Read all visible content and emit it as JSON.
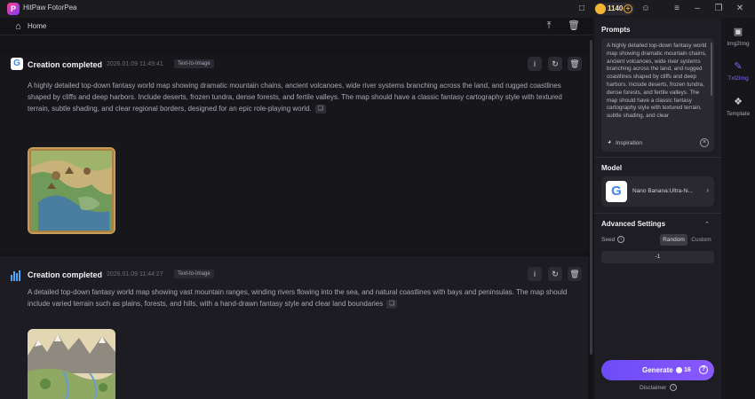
{
  "app": {
    "title": "HitPaw FotorPea",
    "credits": "1140"
  },
  "nav": {
    "home_label": "Home"
  },
  "cards": [
    {
      "title": "Creation completed",
      "time": "2026.01.09   11:49:41",
      "tag": "Text-to-Image",
      "description": "A highly detailed top-down fantasy world map showing dramatic mountain chains, ancient volcanoes, wide river systems branching across the land, and rugged coastlines shaped by cliffs and deep harbors. Include deserts, frozen tundra, dense forests, and fertile valleys. The map should have a classic fantasy cartography style with textured terrain, subtle shading, and clear regional borders, designed for an epic role-playing world."
    },
    {
      "title": "Creation completed",
      "time": "2026.01.09   11:44:27",
      "tag": "Text-to-Image",
      "description": "A detailed top-down fantasy world map showing vast mountain ranges, winding rivers flowing into the sea, and natural coastlines with bays and peninsulas. The map should include varied terrain such as plains, forests, and hills, with a hand-drawn fantasy style and clear land boundaries"
    }
  ],
  "settings": {
    "prompts_title": "Prompts",
    "prompt_text": "A highly detailed top-down fantasy world map showing dramatic mountain chains, ancient volcanoes, wide river systems branching across the land, and rugged coastlines shaped by cliffs and deep harbors. Include deserts, frozen tundra, dense forests, and fertile valleys. The map should have a classic fantasy cartography style with textured terrain, subtle shading, and clear",
    "inspiration_label": "Inspiration",
    "model_title": "Model",
    "model_name": "Nano Banana:Ultra-hi...",
    "advanced_title": "Advanced Settings",
    "seed_label": "Seed",
    "seed_random": "Random",
    "seed_custom": "Custom",
    "seed_value": "-1",
    "generate_label": "Generate",
    "generate_cost": "16",
    "disclaimer": "Disclaimer"
  },
  "rail": [
    {
      "label": "Img2Img",
      "icon": "image-icon",
      "active": false
    },
    {
      "label": "Txt2Img",
      "icon": "text-image-icon",
      "active": true
    },
    {
      "label": "Template",
      "icon": "template-icon",
      "active": false
    }
  ],
  "colors": {
    "accent": "#7b6cff",
    "generate": "#7a52fb",
    "coin": "#f2b632"
  }
}
